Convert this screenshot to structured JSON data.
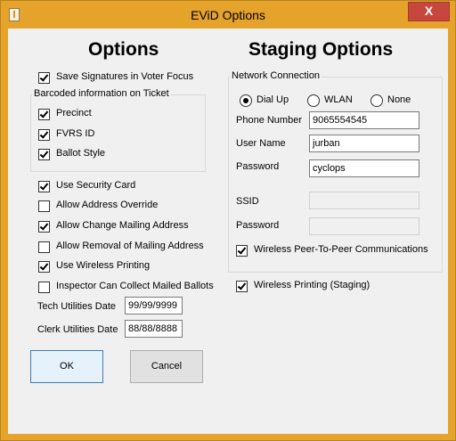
{
  "window": {
    "title": "EViD Options",
    "close_glyph": "X",
    "icon": "app-icon"
  },
  "options": {
    "heading": "Options",
    "save_signatures": {
      "label": "Save Signatures in Voter Focus",
      "checked": true
    },
    "barcode_group": {
      "title": "Barcoded information on Ticket",
      "items": [
        {
          "label": "Precinct",
          "checked": true
        },
        {
          "label": "FVRS ID",
          "checked": true
        },
        {
          "label": "Ballot Style",
          "checked": true
        }
      ]
    },
    "checkboxes": [
      {
        "label": "Use Security Card",
        "checked": true
      },
      {
        "label": "Allow Address Override",
        "checked": false
      },
      {
        "label": "Allow Change Mailing Address",
        "checked": true
      },
      {
        "label": "Allow Removal of Mailing Address",
        "checked": false
      },
      {
        "label": "Use Wireless Printing",
        "checked": true
      },
      {
        "label": "Inspector Can Collect Mailed Ballots",
        "checked": false
      }
    ],
    "tech_utilities": {
      "label": "Tech Utilities Date",
      "value": "99/99/9999"
    },
    "clerk_utilities": {
      "label": "Clerk Utilities Date",
      "value": "88/88/8888"
    }
  },
  "staging": {
    "heading": "Staging Options",
    "network_group": {
      "title": "Network Connection",
      "radios": [
        {
          "label": "Dial Up",
          "checked": true
        },
        {
          "label": "WLAN",
          "checked": false
        },
        {
          "label": "None",
          "checked": false
        }
      ],
      "phone_number": {
        "label": "Phone Number",
        "value": "9065554545"
      },
      "user_name": {
        "label": "User Name",
        "value": "jurban"
      },
      "password": {
        "label": "Password",
        "value": "cyclops"
      },
      "ssid": {
        "label": "SSID",
        "value": ""
      },
      "wlan_password": {
        "label": "Password",
        "value": ""
      },
      "peer_to_peer": {
        "label": "Wireless Peer-To-Peer Communications",
        "checked": true
      }
    },
    "wireless_printing_staging": {
      "label": "Wireless Printing (Staging)",
      "checked": true
    }
  },
  "buttons": {
    "ok": "OK",
    "cancel": "Cancel"
  }
}
